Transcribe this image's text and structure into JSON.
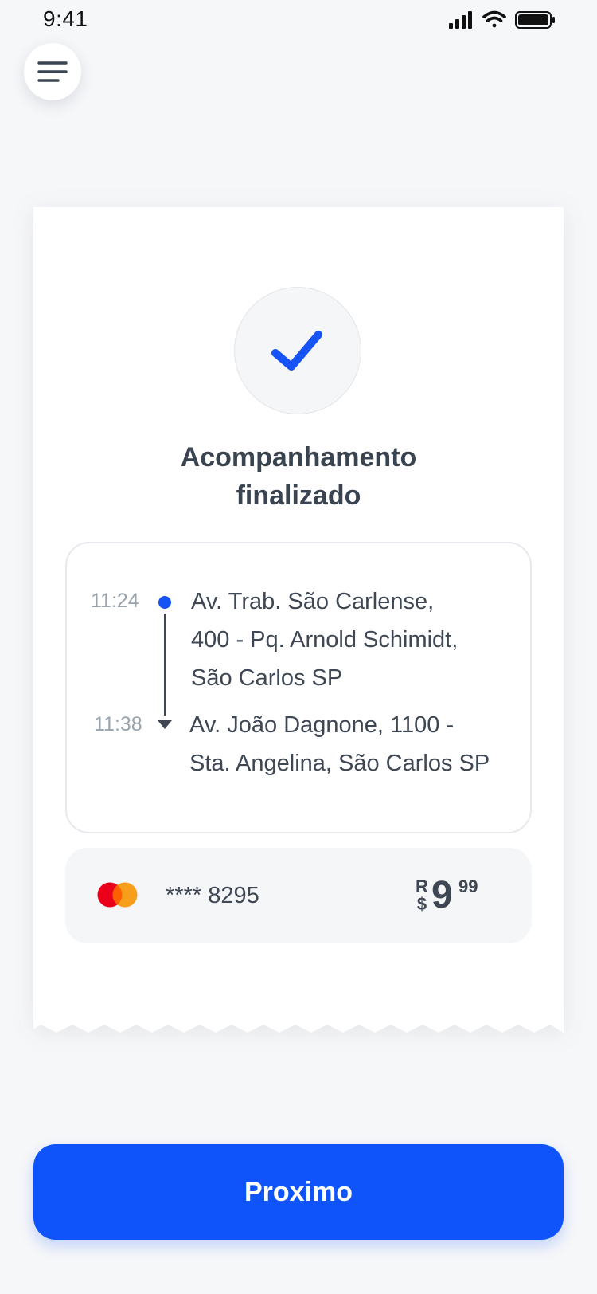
{
  "status_bar": {
    "time": "9:41"
  },
  "colors": {
    "accent": "#0f54fa",
    "text": "#3a4451",
    "muted": "#9aa4ad",
    "background": "#f6f7f9"
  },
  "icons": {
    "menu": "hamburger-menu-icon",
    "status": "check-icon",
    "card_brand": "mastercard-logo"
  },
  "title": {
    "line1": "Acompanhamento",
    "line2": "finalizado"
  },
  "route": {
    "origin": {
      "time": "11:24",
      "address_lines": [
        "Av. Trab. São Carlense,",
        "400 - Pq. Arnold Schimidt,",
        "São Carlos SP"
      ]
    },
    "destination": {
      "time": "11:38",
      "address_lines": [
        "Av. João Dagnone, 1100 -",
        "Sta. Angelina, São Carlos SP"
      ]
    }
  },
  "payment": {
    "card_number": "**** 8295",
    "currency_top": "R",
    "currency_bottom": "$",
    "amount_int": "9",
    "amount_dec": "99"
  },
  "actions": {
    "next_label": "Proximo"
  }
}
